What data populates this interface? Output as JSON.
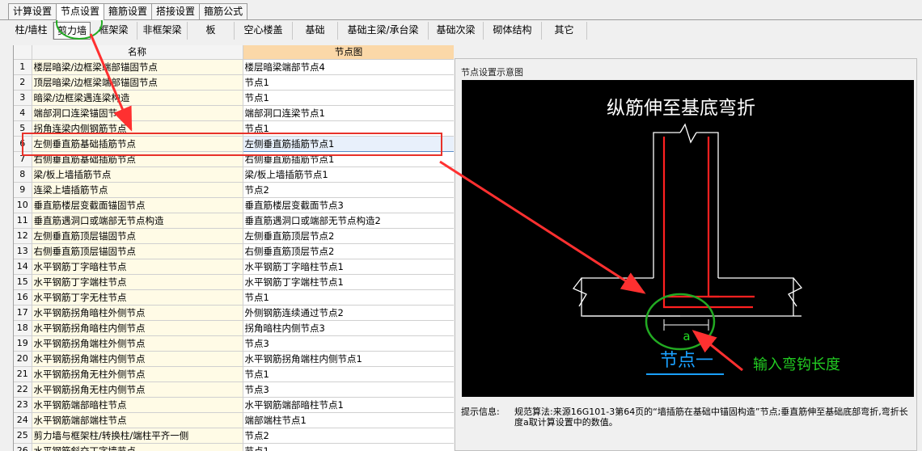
{
  "main_tabs": [
    {
      "label": "计算设置",
      "active": false
    },
    {
      "label": "节点设置",
      "active": true
    },
    {
      "label": "箍筋设置",
      "active": false
    },
    {
      "label": "搭接设置",
      "active": false
    },
    {
      "label": "箍筋公式",
      "active": false
    }
  ],
  "sub_tabs": [
    {
      "label": "柱/墙柱",
      "active": false
    },
    {
      "label": "剪力墙",
      "active": true
    },
    {
      "label": "框架梁",
      "active": false
    },
    {
      "label": "非框架梁",
      "active": false
    },
    {
      "label": "板",
      "active": false
    },
    {
      "label": "空心楼盖",
      "active": false
    },
    {
      "label": "基础",
      "active": false
    },
    {
      "label": "基础主梁/承台梁",
      "active": false
    },
    {
      "label": "基础次梁",
      "active": false
    },
    {
      "label": "砌体结构",
      "active": false
    },
    {
      "label": "其它",
      "active": false
    }
  ],
  "table": {
    "col_name": "名称",
    "col_node": "节点图",
    "rows": [
      {
        "num": "1",
        "name": "楼层暗梁/边框梁端部锚固节点",
        "node": "楼层暗梁端部节点4"
      },
      {
        "num": "2",
        "name": "顶层暗梁/边框梁端部锚固节点",
        "node": "节点1"
      },
      {
        "num": "3",
        "name": "暗梁/边框梁遇连梁构造",
        "node": "节点1"
      },
      {
        "num": "4",
        "name": "端部洞口连梁锚固节点",
        "node": "端部洞口连梁节点1"
      },
      {
        "num": "5",
        "name": "拐角连梁内侧钢筋节点",
        "node": "节点1"
      },
      {
        "num": "6",
        "name": "左侧垂直筋基础插筋节点",
        "node": "左侧垂直筋插筋节点1",
        "selected": true
      },
      {
        "num": "7",
        "name": "右侧垂直筋基础插筋节点",
        "node": "右侧垂直筋插筋节点1"
      },
      {
        "num": "8",
        "name": "梁/板上墙插筋节点",
        "node": "梁/板上墙插筋节点1"
      },
      {
        "num": "9",
        "name": "连梁上墙插筋节点",
        "node": "节点2"
      },
      {
        "num": "10",
        "name": "垂直筋楼层变截面锚固节点",
        "node": "垂直筋楼层变截面节点3"
      },
      {
        "num": "11",
        "name": "垂直筋遇洞口或端部无节点构造",
        "node": "垂直筋遇洞口或端部无节点构造2"
      },
      {
        "num": "12",
        "name": "左侧垂直筋顶层锚固节点",
        "node": "左侧垂直筋顶层节点2"
      },
      {
        "num": "13",
        "name": "右侧垂直筋顶层锚固节点",
        "node": "右侧垂直筋顶层节点2"
      },
      {
        "num": "14",
        "name": "水平钢筋丁字暗柱节点",
        "node": "水平钢筋丁字暗柱节点1"
      },
      {
        "num": "15",
        "name": "水平钢筋丁字端柱节点",
        "node": "水平钢筋丁字端柱节点1"
      },
      {
        "num": "16",
        "name": "水平钢筋丁字无柱节点",
        "node": "节点1"
      },
      {
        "num": "17",
        "name": "水平钢筋拐角暗柱外侧节点",
        "node": "外侧钢筋连续通过节点2"
      },
      {
        "num": "18",
        "name": "水平钢筋拐角暗柱内侧节点",
        "node": "拐角暗柱内侧节点3"
      },
      {
        "num": "19",
        "name": "水平钢筋拐角端柱外侧节点",
        "node": "节点3"
      },
      {
        "num": "20",
        "name": "水平钢筋拐角端柱内侧节点",
        "node": "水平钢筋拐角端柱内侧节点1"
      },
      {
        "num": "21",
        "name": "水平钢筋拐角无柱外侧节点",
        "node": "节点1"
      },
      {
        "num": "22",
        "name": "水平钢筋拐角无柱内侧节点",
        "node": "节点3"
      },
      {
        "num": "23",
        "name": "水平钢筋端部暗柱节点",
        "node": "水平钢筋端部暗柱节点1"
      },
      {
        "num": "24",
        "name": "水平钢筋端部端柱节点",
        "node": "端部端柱节点1"
      },
      {
        "num": "25",
        "name": "剪力墙与框架柱/转换柱/端柱平齐一侧",
        "node": "节点2"
      },
      {
        "num": "26",
        "name": "水平钢筋斜交丁字墙节点",
        "node": "节点1"
      }
    ]
  },
  "panel": {
    "title": "节点设置示意图",
    "diagram_title": "纵筋伸至基底弯折",
    "dim_label": "a",
    "node_label": "节点一",
    "annotation": "输入弯钩长度",
    "hint_label": "提示信息:",
    "hint_text": "规范算法:来源16G101-3第64页的“墙插筋在基础中锚固构造”节点;垂直筋伸至基础底部弯折,弯折长度a取计算设置中的数值。"
  },
  "colors": {
    "rebar": "#ff2020",
    "annotation": "#ff3030",
    "highlight_green": "#22aa22",
    "title_blue": "#1aa0ff"
  }
}
